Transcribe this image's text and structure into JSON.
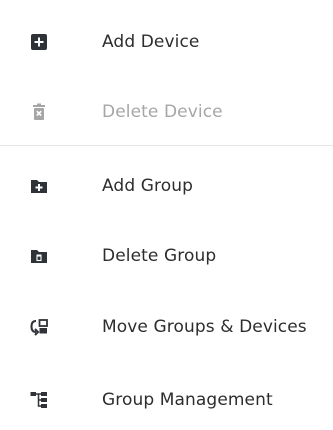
{
  "menu": {
    "items": [
      {
        "label": "Add Device",
        "icon": "add-device-icon",
        "enabled": true
      },
      {
        "label": "Delete Device",
        "icon": "delete-device-icon",
        "enabled": false
      },
      {
        "label": "Add Group",
        "icon": "add-group-icon",
        "enabled": true
      },
      {
        "label": "Delete Group",
        "icon": "delete-group-icon",
        "enabled": true
      },
      {
        "label": "Move Groups & Devices",
        "icon": "move-icon",
        "enabled": true
      },
      {
        "label": "Group Management",
        "icon": "group-management-icon",
        "enabled": true
      }
    ]
  },
  "colors": {
    "icon": "#2f3338",
    "icon_disabled": "#a6a6a6",
    "label": "#2d2d2d",
    "label_disabled": "#a6a6a6",
    "divider": "#e6e6e6"
  }
}
